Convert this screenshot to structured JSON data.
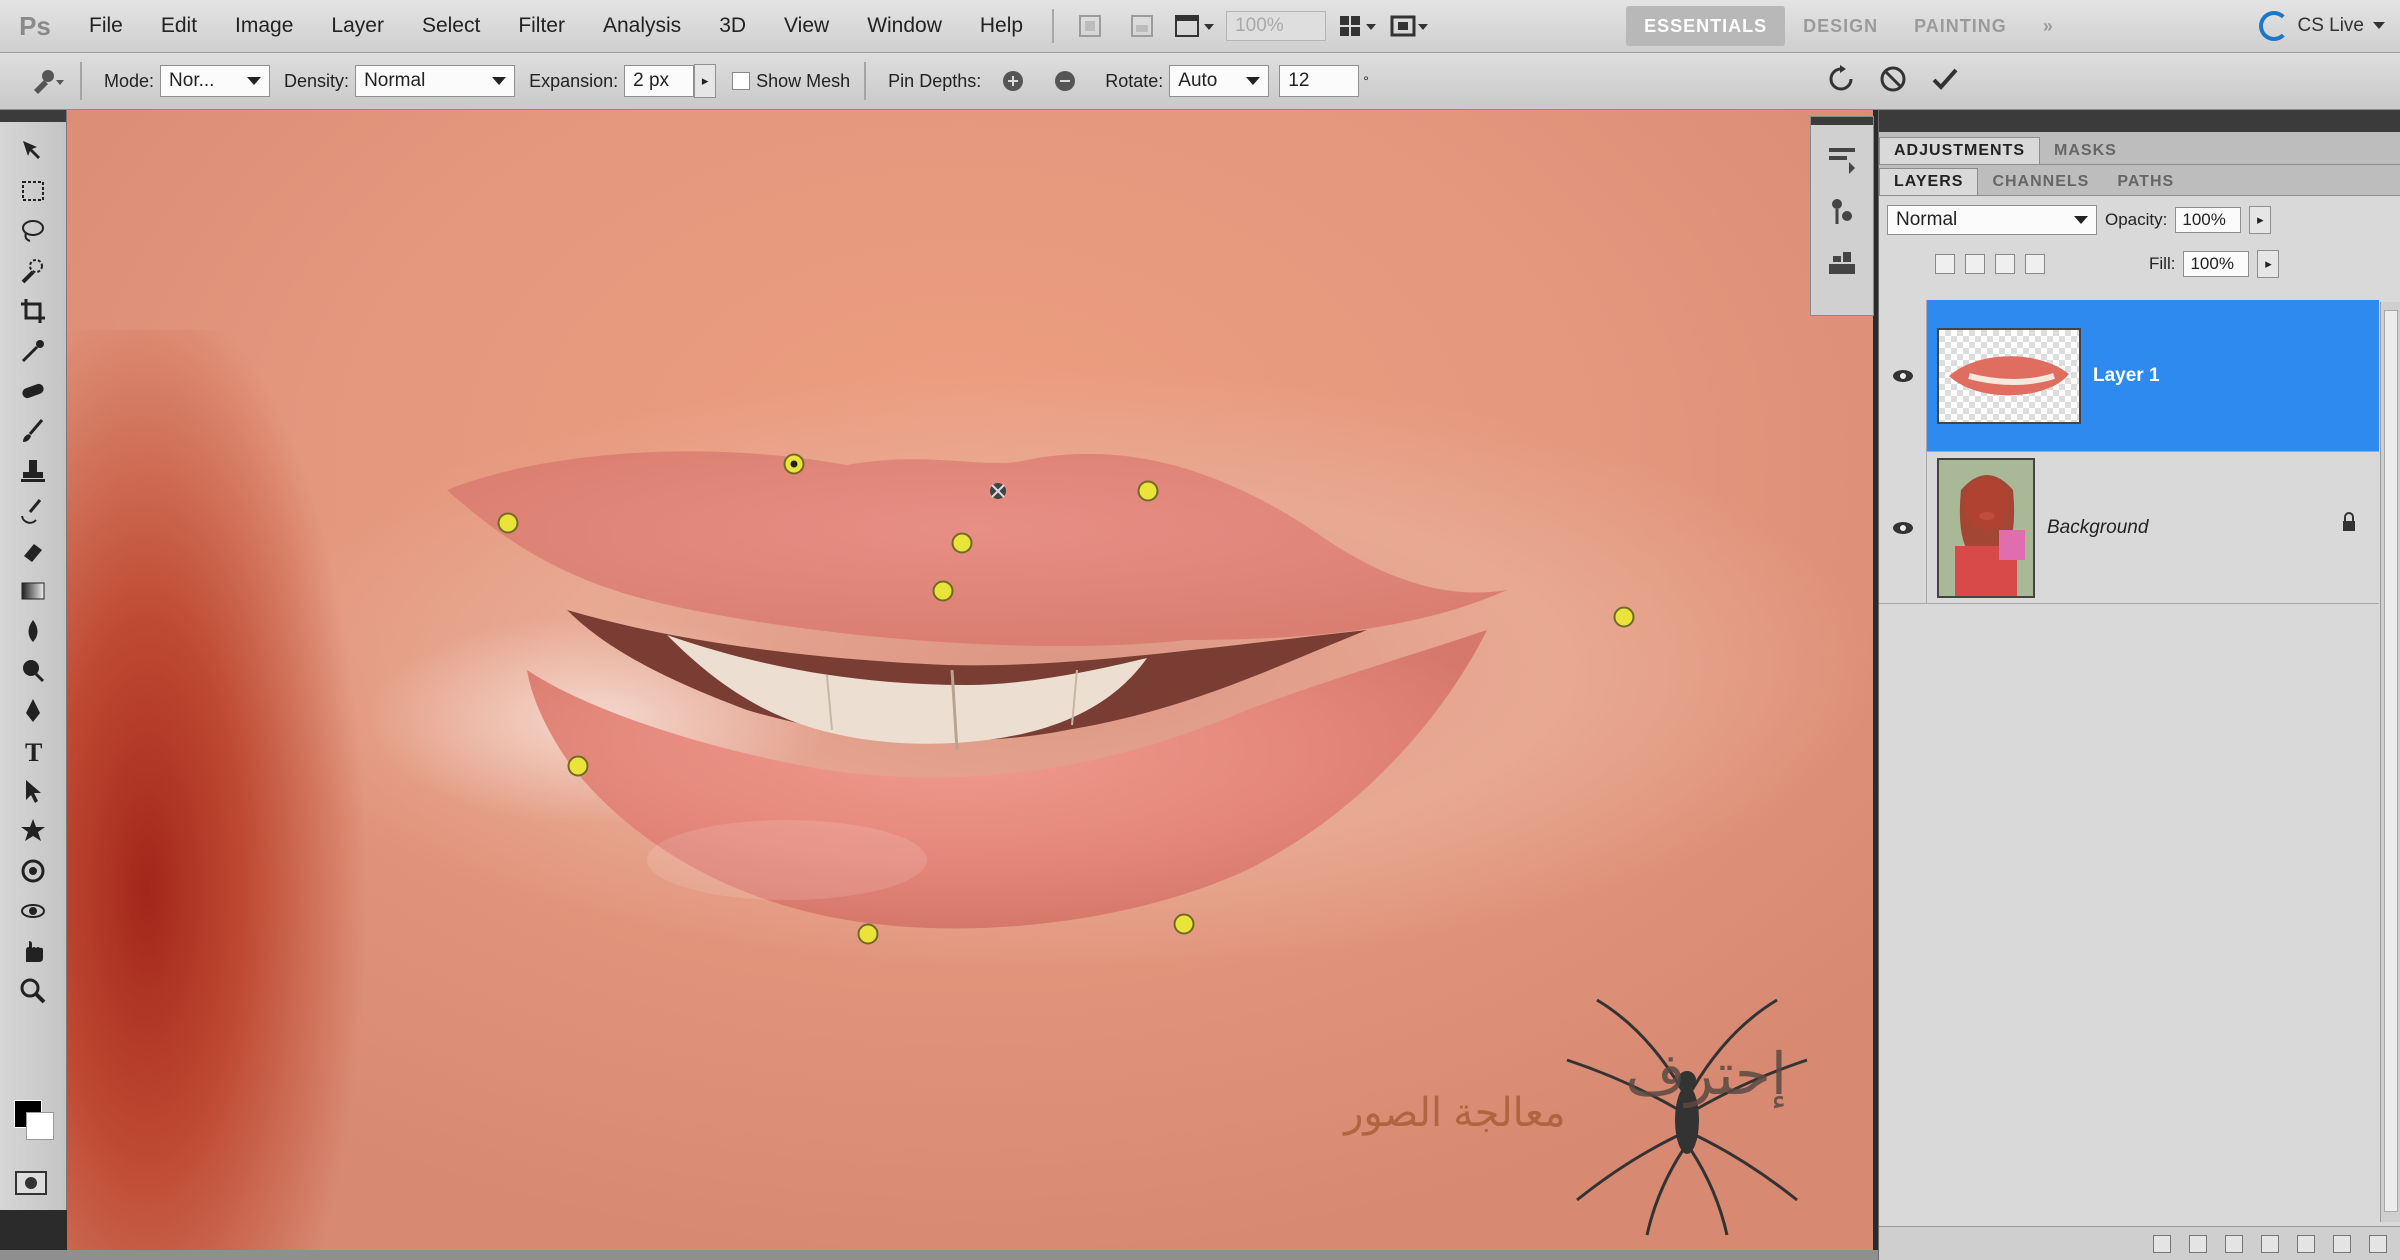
{
  "app": {
    "logo": "Ps",
    "menu": [
      "File",
      "Edit",
      "Image",
      "Layer",
      "Select",
      "Filter",
      "Analysis",
      "3D",
      "View",
      "Window",
      "Help"
    ],
    "zoom": "100%",
    "workspaces": [
      "ESSENTIALS",
      "DESIGN",
      "PAINTING"
    ],
    "more": "»",
    "cs_live": "CS Live"
  },
  "options": {
    "mode_label": "Mode:",
    "mode_value": "Nor...",
    "density_label": "Density:",
    "density_value": "Normal",
    "expansion_label": "Expansion:",
    "expansion_value": "2 px",
    "show_mesh_label": "Show Mesh",
    "show_mesh_checked": false,
    "pin_depth_label": "Pin Depths:",
    "rotate_label": "Rotate:",
    "rotate_value": "Auto",
    "rotate_angle": "12"
  },
  "canvas": {
    "pins_count": 11,
    "watermark_arabic": "إحترف",
    "watermark_arabic_sub": "معالجة الصور"
  },
  "panels": {
    "top_tabs": [
      "ADJUSTMENTS",
      "MASKS"
    ],
    "layer_tabs": [
      "LAYERS",
      "CHANNELS",
      "PATHS"
    ],
    "blend_mode": "Normal",
    "opacity_label": "Opacity:",
    "opacity_value": "100%",
    "fill_label": "Fill:",
    "fill_value": "100%",
    "layers": [
      {
        "name": "Layer 1",
        "selected": true,
        "visible": true
      },
      {
        "name": "Background",
        "selected": false,
        "visible": true,
        "locked": true
      }
    ]
  },
  "colors": {
    "selection_blue": "#2f8af0",
    "pin_yellow": "#e9e33a",
    "cs_live_blue": "#1c78c6"
  }
}
